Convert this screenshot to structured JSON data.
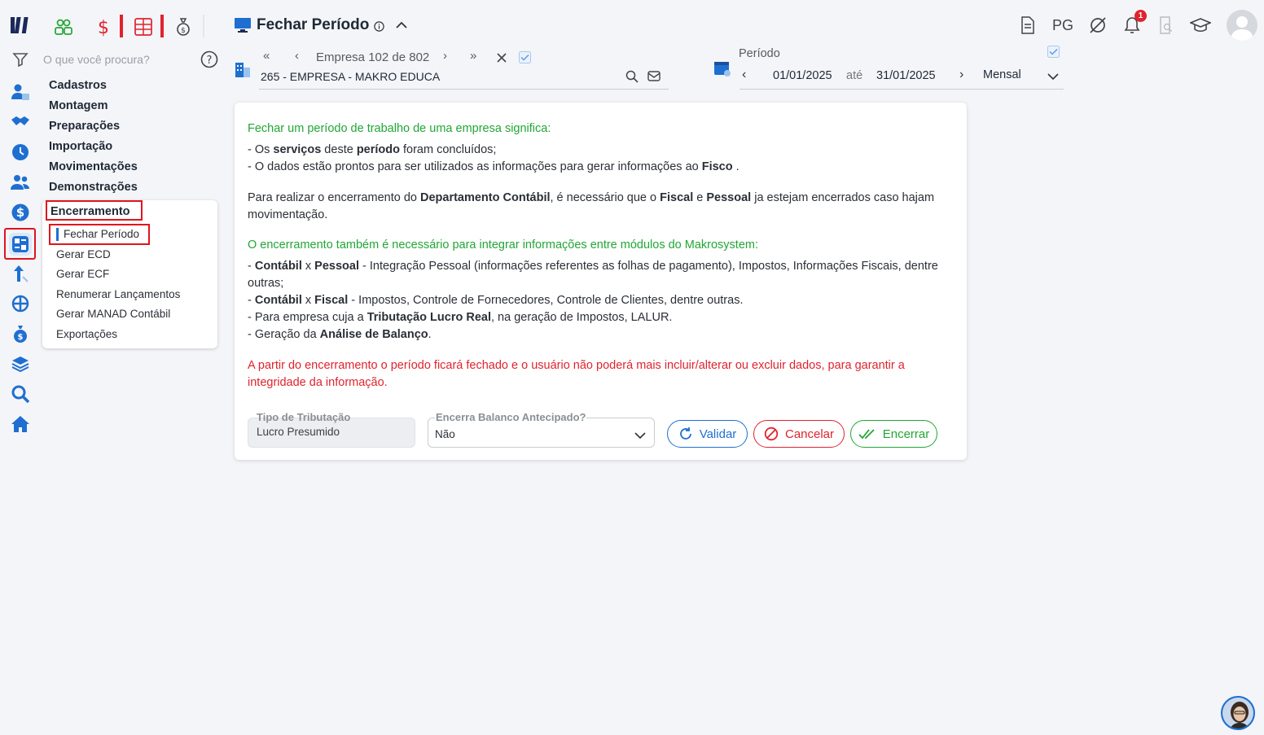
{
  "search": {
    "placeholder": "O que você procura?"
  },
  "menu": {
    "items": [
      "Cadastros",
      "Montagem",
      "Preparações",
      "Importação",
      "Movimentações",
      "Demonstrações",
      "Encerramento"
    ],
    "submenu": [
      "Fechar Período",
      "Gerar ECD",
      "Gerar ECF",
      "Renumerar Lançamentos",
      "Gerar MANAD Contábil",
      "Exportações"
    ]
  },
  "header": {
    "title": "Fechar Período",
    "pg_label": "PG",
    "notification_count": "1"
  },
  "empresa": {
    "nav_label": "Empresa 102 de 802",
    "name": "265 - EMPRESA - MAKRO EDUCA"
  },
  "periodo": {
    "label": "Período",
    "start": "01/01/2025",
    "separator": "até",
    "end": "31/01/2025",
    "frequency": "Mensal"
  },
  "content": {
    "intro_heading": "Fechar um período de trabalho de uma empresa significa:",
    "line1": {
      "a": "- Os ",
      "b": "serviços",
      "c": " deste ",
      "d": "período",
      "e": " foram concluídos;"
    },
    "line2": {
      "a": "- O dados estão prontos para ser utilizados as informações para gerar informações ao ",
      "b": "Fisco",
      "c": " ."
    },
    "para1": {
      "a": "Para realizar o encerramento do ",
      "b": "Departamento Contábil",
      "c": ", é necessário que o ",
      "d": "Fiscal",
      "e": " e ",
      "f": "Pessoal",
      "g": " ja estejam encerrados caso hajam movimentação."
    },
    "integ_heading": "O encerramento também é necessário para integrar informações entre módulos do Makrosystem:",
    "b1": {
      "a": "- ",
      "b": "Contábil",
      "c": " x ",
      "d": "Pessoal",
      "e": " - Integração Pessoal (informações referentes as folhas de pagamento), Impostos, Informações Fiscais, dentre outras;"
    },
    "b2": {
      "a": "- ",
      "b": "Contábil",
      "c": " x ",
      "d": "Fiscal",
      "e": " - Impostos, Controle de Fornecedores, Controle de Clientes, dentre outras."
    },
    "b3": {
      "a": "- Para empresa cuja a ",
      "b": "Tributação Lucro Real",
      "c": ", na geração de Impostos, LALUR."
    },
    "b4": {
      "a": "- Geração da ",
      "b": "Análise de Balanço",
      "c": "."
    },
    "warning": "A partir do encerramento o período ficará fechado e o usuário não poderá mais incluir/alterar ou excluir dados, para garantir a integridade da informação."
  },
  "form": {
    "tipo_label": "Tipo de Tributação",
    "tipo_value": "Lucro Presumido",
    "antecipado_label": "Encerra Balanco Antecipado?",
    "antecipado_value": "Não"
  },
  "buttons": {
    "validar": "Validar",
    "cancelar": "Cancelar",
    "encerrar": "Encerrar"
  },
  "colors": {
    "accent_blue": "#1f6fd1",
    "green": "#22a635",
    "red": "#e0232e",
    "navy": "#1b2a5a"
  }
}
